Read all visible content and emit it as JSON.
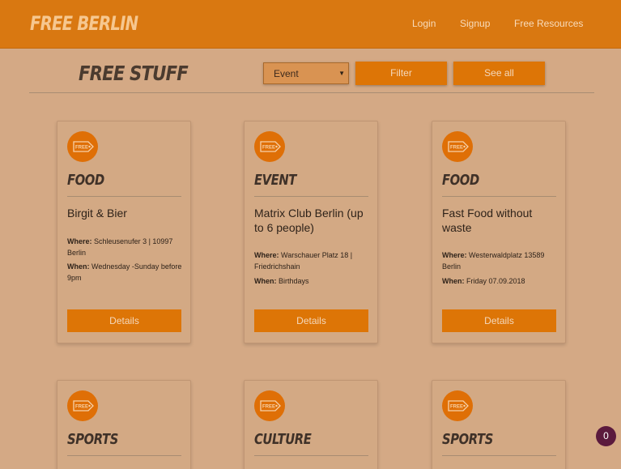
{
  "navbar": {
    "brand": "FREE BERLIN",
    "links": [
      "Login",
      "Signup",
      "Free Resources"
    ]
  },
  "toolbar": {
    "title": "FREE STUFF",
    "select_value": "Event",
    "filter_label": "Filter",
    "see_all_label": "See all"
  },
  "icon_text": "FREE",
  "cards": [
    {
      "category": "FOOD",
      "name": "Birgit & Bier",
      "where_label": "Where:",
      "where": "Schleusenufer 3 | 10997 Berlin",
      "when_label": "When:",
      "when": "Wednesday -Sunday before 9pm",
      "details_label": "Details"
    },
    {
      "category": "EVENT",
      "name": "Matrix Club Berlin (up to 6 people)",
      "where_label": "Where:",
      "where": "Warschauer Platz 18 | Friedrichshain",
      "when_label": "When:",
      "when": "Birthdays",
      "details_label": "Details"
    },
    {
      "category": "FOOD",
      "name": "Fast Food without waste",
      "where_label": "Where:",
      "where": "Westerwaldplatz 13589 Berlin",
      "when_label": "When:",
      "when": "Friday 07.09.2018",
      "details_label": "Details"
    },
    {
      "category": "SPORTS"
    },
    {
      "category": "CULTURE"
    },
    {
      "category": "SPORTS"
    }
  ],
  "badge_count": "0",
  "colors": {
    "navbar": "#d97811",
    "background": "#d4a985",
    "button": "#dd7506",
    "badge": "#5b1a3d"
  }
}
